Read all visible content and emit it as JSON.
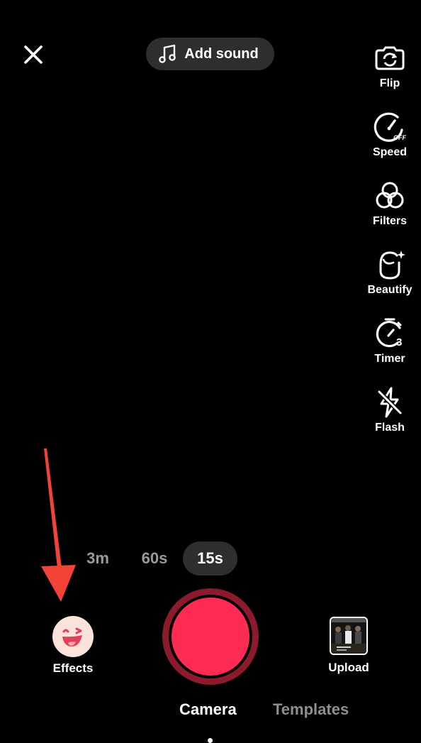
{
  "header": {
    "close_icon": "close-icon",
    "add_sound_label": "Add sound",
    "music_icon": "music-note-icon"
  },
  "tools": [
    {
      "label": "Flip",
      "icon": "flip-camera-icon"
    },
    {
      "label": "Speed",
      "icon": "speed-icon",
      "badge": "OFF"
    },
    {
      "label": "Filters",
      "icon": "filters-icon"
    },
    {
      "label": "Beautify",
      "icon": "beautify-icon"
    },
    {
      "label": "Timer",
      "icon": "timer-icon",
      "badge": "3"
    },
    {
      "label": "Flash",
      "icon": "flash-off-icon"
    }
  ],
  "durations": [
    {
      "label": "3m",
      "selected": false
    },
    {
      "label": "60s",
      "selected": false
    },
    {
      "label": "15s",
      "selected": true
    }
  ],
  "bottom": {
    "effects_label": "Effects",
    "upload_label": "Upload"
  },
  "tabs": [
    {
      "label": "Camera",
      "selected": true
    },
    {
      "label": "Templates",
      "selected": false
    }
  ],
  "colors": {
    "record": "#fe2c55",
    "record_ring": "#8c1a2c",
    "annotation_arrow": "#f44336",
    "pill_bg": "#2e2e2e"
  }
}
